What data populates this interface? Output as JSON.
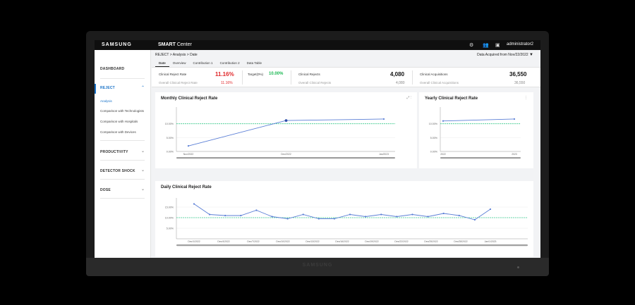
{
  "topbar": {
    "brand": "SAMSUNG",
    "app_name_bold": "SMART",
    "app_name_rest": " Center",
    "icons": [
      "gear-icon",
      "users-icon",
      "calendar-icon"
    ],
    "user": "administrator2"
  },
  "sidebar": {
    "items": [
      {
        "label": "DASHBOARD"
      },
      {
        "label": "REJECT",
        "chevron": "^"
      },
      {
        "label": "PRODUCTIVITY",
        "chevron": "v"
      },
      {
        "label": "DETECTOR SHOCK",
        "chevron": "v"
      },
      {
        "label": "DOSE",
        "chevron": "v"
      }
    ],
    "sub_items": [
      {
        "label": "Analysis"
      },
      {
        "label": "Comparison with Technologists"
      },
      {
        "label": "Comparison with Hospitals"
      },
      {
        "label": "Comparison with Devices"
      }
    ]
  },
  "header": {
    "breadcrumb": "REJECT > Analysis > Date",
    "acquired": "Data Acquired from Nov/22/2022",
    "filter_icon": "filter-icon"
  },
  "tabs": [
    {
      "label": "Date"
    },
    {
      "label": "Overview"
    },
    {
      "label": "Contribution 1"
    },
    {
      "label": "Contribution 2"
    },
    {
      "label": "Data Table"
    }
  ],
  "kpis": {
    "reject_rate_label": "Clinical Reject Rate",
    "reject_rate_value": "11.16%",
    "overall_reject_rate_label": "Overall Clinical Reject Rate",
    "overall_reject_rate_value": "11.16%",
    "target_label": "Target(0%)",
    "target_value": "10.00%",
    "rejects_label": "Clinical Rejects",
    "rejects_value": "4,080",
    "overall_rejects_label": "Overall Clinical Rejects",
    "overall_rejects_value": "4,080",
    "acquisitions_label": "Clinical Acquisitions",
    "acquisitions_value": "36,550",
    "overall_acquisitions_label": "Overall Clinical Acquisitions",
    "overall_acquisitions_value": "36,550"
  },
  "panels": {
    "monthly_title": "Monthly Clinical Reject Rate",
    "monthly_icons": "⤢  ⋮",
    "yearly_title": "Yearly Clinical Reject Rate",
    "yearly_icons": "⋮",
    "daily_title": "Daily Clinical Reject Rate"
  },
  "colors": {
    "line": "#5b7fd6",
    "target": "#3ccf8e",
    "accent": "#1a73c8",
    "kpi_red": "#e0292b",
    "kpi_green": "#1db954"
  },
  "chart_data": [
    {
      "type": "line",
      "title": "Monthly Clinical Reject Rate",
      "yticks": [
        "10.00%",
        "5.00%",
        "0.00%"
      ],
      "ylim": [
        0,
        15
      ],
      "target": 10,
      "x": [
        "Nov/2022",
        "Dec/2022",
        "Jan/2023"
      ],
      "values": [
        2.0,
        11.16,
        11.7
      ],
      "grid": true
    },
    {
      "type": "line",
      "title": "Yearly Clinical Reject Rate",
      "yticks": [
        "10.00%",
        "5.00%",
        "0.00%"
      ],
      "ylim": [
        0,
        15
      ],
      "target": 10,
      "x": [
        "2022",
        "2023"
      ],
      "values": [
        11.0,
        11.7
      ],
      "grid": true
    },
    {
      "type": "line",
      "title": "Daily Clinical Reject Rate",
      "yticks": [
        "15.00%",
        "10.00%",
        "5.00%"
      ],
      "ylim": [
        0,
        18
      ],
      "target": 10,
      "x_labels": [
        "Dec/1/2022",
        "Dec/4/2022",
        "Dec/7/2022",
        "Dec/10/2022",
        "Dec/13/2022",
        "Dec/16/2022",
        "Dec/19/2022",
        "Dec/22/2022",
        "Dec/25/2022",
        "Dec/28/2022",
        "Jan/1/2023"
      ],
      "values": [
        16.5,
        11.5,
        11.0,
        11.0,
        13.5,
        10.5,
        9.5,
        11.5,
        9.5,
        9.5,
        11.5,
        10.5,
        11.5,
        10.5,
        11.5,
        10.5,
        12.0,
        11.0,
        9.0,
        14.0
      ],
      "grid": true
    }
  ]
}
